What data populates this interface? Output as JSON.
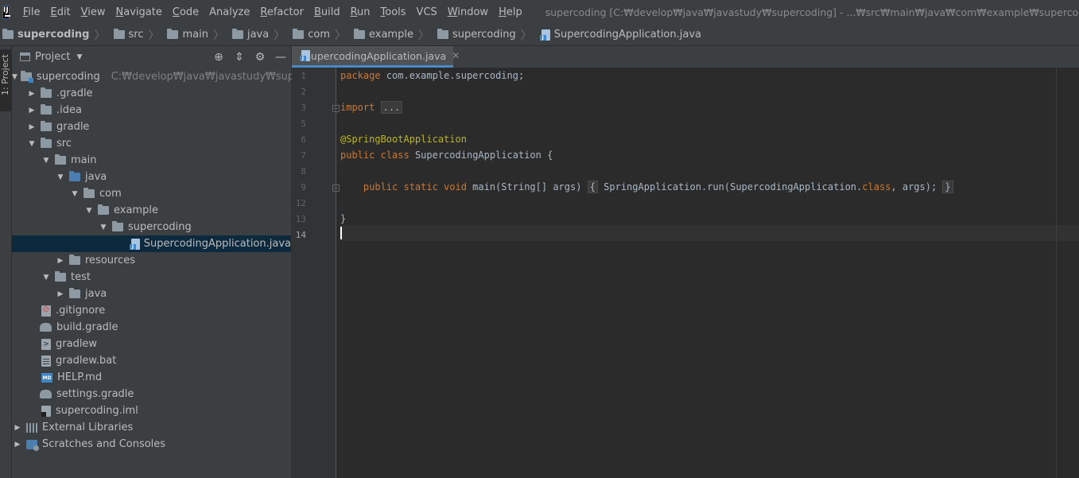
{
  "menubar": {
    "items": [
      {
        "label": "File",
        "mnemonic": "F",
        "rest": "ile"
      },
      {
        "label": "Edit",
        "mnemonic": "E",
        "rest": "dit"
      },
      {
        "label": "View",
        "mnemonic": "V",
        "rest": "iew"
      },
      {
        "label": "Navigate",
        "mnemonic": "N",
        "rest": "avigate"
      },
      {
        "label": "Code",
        "mnemonic": "C",
        "rest": "ode"
      },
      {
        "label": "Analyze",
        "mnemonic": "",
        "rest": "Analyze"
      },
      {
        "label": "Refactor",
        "mnemonic": "R",
        "rest": "efactor"
      },
      {
        "label": "Build",
        "mnemonic": "B",
        "rest": "uild"
      },
      {
        "label": "Run",
        "mnemonic": "R",
        "rest": "un"
      },
      {
        "label": "Tools",
        "mnemonic": "T",
        "rest": "ools"
      },
      {
        "label": "VCS",
        "mnemonic": "",
        "rest": "VCS"
      },
      {
        "label": "Window",
        "mnemonic": "W",
        "rest": "indow"
      },
      {
        "label": "Help",
        "mnemonic": "H",
        "rest": "elp"
      }
    ],
    "window_title": "supercoding [C:₩develop₩java₩javastudy₩supercoding] - ...₩src₩main₩java₩com₩example₩supercoding₩SupercodingApplication.java -"
  },
  "breadcrumbs": [
    "supercoding",
    "src",
    "main",
    "java",
    "com",
    "example",
    "supercoding",
    "SupercodingApplication.java"
  ],
  "sidebar": {
    "vertical_tab": "1: Project"
  },
  "project_panel": {
    "title": "Project",
    "tools": {
      "locate": "⊕",
      "collapse": "⇕",
      "settings": "⚙",
      "hide": "—"
    }
  },
  "tree": {
    "root_name": "supercoding",
    "root_path": "C:₩develop₩java₩javastudy₩supercoding",
    "gradle_dot": ".gradle",
    "idea": ".idea",
    "gradle": "gradle",
    "src": "src",
    "main": "main",
    "java": "java",
    "com": "com",
    "example": "example",
    "supercoding": "supercoding",
    "app_file": "SupercodingApplication.java",
    "resources": "resources",
    "test": "test",
    "test_java": "java",
    "gitignore": ".gitignore",
    "build_gradle": "build.gradle",
    "gradlew": "gradlew",
    "gradlew_bat": "gradlew.bat",
    "help_md": "HELP.md",
    "settings_gradle": "settings.gradle",
    "iml": "supercoding.iml",
    "external_libraries": "External Libraries",
    "scratches": "Scratches and Consoles"
  },
  "editor": {
    "tab_label": "SupercodingApplication.java",
    "line_numbers": [
      "1",
      "2",
      "3",
      "5",
      "6",
      "7",
      "8",
      "9",
      "12",
      "13",
      "14"
    ],
    "code": {
      "pkg_kw": "package",
      "pkg_name": " com.example.supercoding;",
      "import_kw": "import",
      "import_fold": "...",
      "annotation": "@SpringBootApplication",
      "public_kw": "public",
      "class_kw": "class",
      "class_name": " SupercodingApplication {",
      "method_mods": "public static void",
      "method_sig": " main(String[] args)",
      "fold_open": "{",
      "body_pre": " SpringApplication.run(SupercodingApplication.",
      "body_class": "class",
      "body_post": ", args);",
      "fold_close": "}",
      "closing_brace": "}"
    }
  }
}
